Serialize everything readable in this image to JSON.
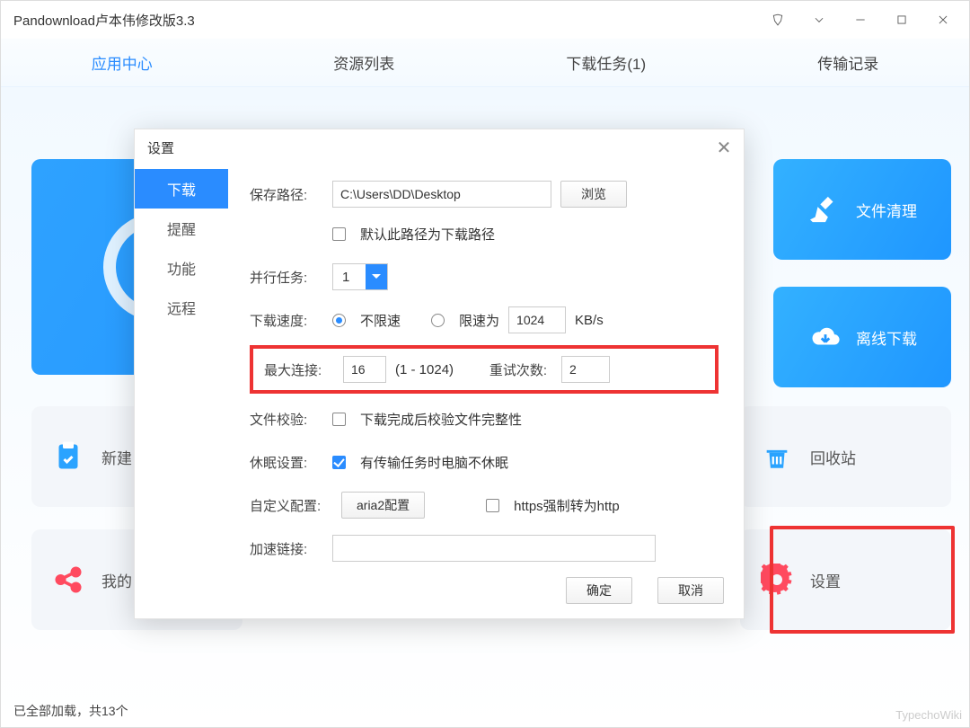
{
  "window": {
    "title": "Pandownload卢本伟修改版3.3"
  },
  "tabs": [
    {
      "label": "应用中心",
      "active": true
    },
    {
      "label": "资源列表"
    },
    {
      "label": "下载任务(1)"
    },
    {
      "label": "传输记录"
    }
  ],
  "rightCards": {
    "clean": "文件清理",
    "offline": "离线下载"
  },
  "tiles": {
    "new": "新建",
    "my": "我的",
    "recycle": "回收站",
    "settings": "设置"
  },
  "status": "已全部加载，共13个",
  "watermark": "TypechoWiki",
  "dialog": {
    "title": "设置",
    "side": [
      "下载",
      "提醒",
      "功能",
      "远程"
    ],
    "sideActiveIndex": 0,
    "savePath": {
      "label": "保存路径:",
      "value": "C:\\Users\\DD\\Desktop",
      "browse": "浏览",
      "defaultCheckbox": "默认此路径为下载路径",
      "defaultChecked": false
    },
    "parallel": {
      "label": "并行任务:",
      "value": "1"
    },
    "speed": {
      "label": "下载速度:",
      "unlimited": "不限速",
      "limited": "限速为",
      "limitValue": "1024",
      "unit": "KB/s",
      "selected": "unlimited"
    },
    "conn": {
      "label": "最大连接:",
      "value": "16",
      "range": "(1 - 1024)",
      "retryLabel": "重试次数:",
      "retryValue": "2"
    },
    "verify": {
      "label": "文件校验:",
      "text": "下载完成后校验文件完整性",
      "checked": false
    },
    "sleep": {
      "label": "休眠设置:",
      "text": "有传输任务时电脑不休眠",
      "checked": true
    },
    "custom": {
      "label": "自定义配置:",
      "button": "aria2配置",
      "httpsForce": "https强制转为http",
      "httpsChecked": false
    },
    "accel": {
      "label": "加速链接:",
      "value": ""
    },
    "buttons": {
      "ok": "确定",
      "cancel": "取消"
    }
  }
}
